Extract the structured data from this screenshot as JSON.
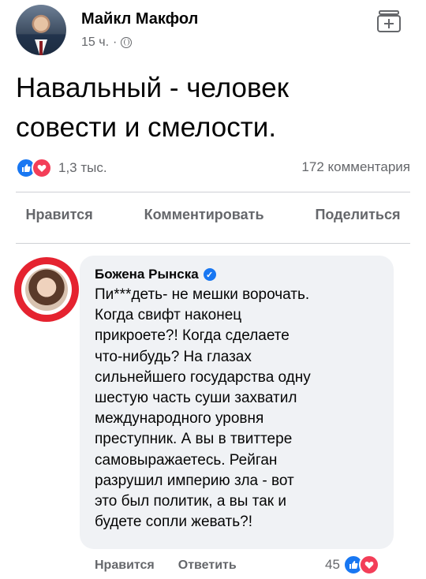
{
  "post": {
    "author": "Майкл Макфол",
    "time": "15 ч.",
    "separator": "·",
    "text_lines": [
      "Навальный - человек",
      "совести и смелости."
    ],
    "reaction_count": "1,3 тыс.",
    "comment_count": "172 комментария"
  },
  "actions": {
    "like": "Нравится",
    "comment": "Комментировать",
    "share": "Поделиться"
  },
  "comment": {
    "author": "Божена Рынска",
    "text_lines": [
      "Пи***деть- не мешки ворочать.",
      "Когда свифт наконец",
      "прикроете?! Когда сделаете",
      "что-нибудь? На глазах",
      "сильнейшего государства одну",
      "шестую часть суши захватил",
      "международного уровня",
      "преступник. А вы в твиттере",
      "самовыражаетесь. Рейган",
      "разрушил империю зла - вот",
      "это был политик, а вы так и",
      "будете сопли жевать?!"
    ],
    "like_label": "Нравится",
    "reply_label": "Ответить",
    "reaction_count": "45"
  },
  "icons": {
    "like": "like-icon",
    "love": "heart-icon",
    "globe": "globe-icon",
    "add": "add-to-collection-icon",
    "verified": "verified-badge-icon"
  },
  "colors": {
    "like_blue": "#1877f2",
    "love_red": "#f33e58",
    "secondary_text": "#65676b",
    "bubble_bg": "#f0f2f5"
  }
}
